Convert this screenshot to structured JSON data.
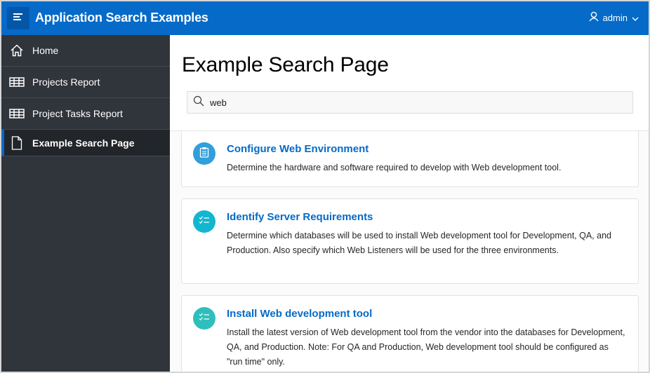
{
  "header": {
    "app_title": "Application Search Examples",
    "menu_icon": "hamburger-icon",
    "user": {
      "name": "admin",
      "icon": "user-icon",
      "chevron": "chevron-down-icon"
    }
  },
  "sidebar": {
    "items": [
      {
        "label": "Home",
        "icon": "home-icon",
        "active": false
      },
      {
        "label": "Projects Report",
        "icon": "table-icon",
        "active": false
      },
      {
        "label": "Project Tasks Report",
        "icon": "table-icon",
        "active": false
      },
      {
        "label": "Example Search Page",
        "icon": "file-icon",
        "active": true
      }
    ]
  },
  "main": {
    "page_title": "Example Search Page",
    "search": {
      "value": "web",
      "icon": "search-icon"
    },
    "results": [
      {
        "title": "Configure Web Environment",
        "description": "Determine the hardware and software required to develop with Web development tool.",
        "icon": "clipboard-icon",
        "icon_color": "#309fdb"
      },
      {
        "title": "Identify Server Requirements",
        "description": "Determine which databases will be used to install Web development tool for Development, QA, and Production. Also specify which Web Listeners will be used for the three environments.",
        "icon": "checklist-icon",
        "icon_color": "#13b6cf"
      },
      {
        "title": "Install Web development tool",
        "description": "Install the latest version of Web development tool from the vendor into the databases for Development, QA, and Production. Note: For QA and Production, Web development tool should be configured as \"run time\" only.",
        "icon": "checklist-icon",
        "icon_color": "#2ebfbc"
      }
    ]
  },
  "colors": {
    "header_bg": "#056ac8",
    "sidebar_bg": "#30343b",
    "active_indicator": "#056ac8",
    "link": "#056ac8"
  }
}
